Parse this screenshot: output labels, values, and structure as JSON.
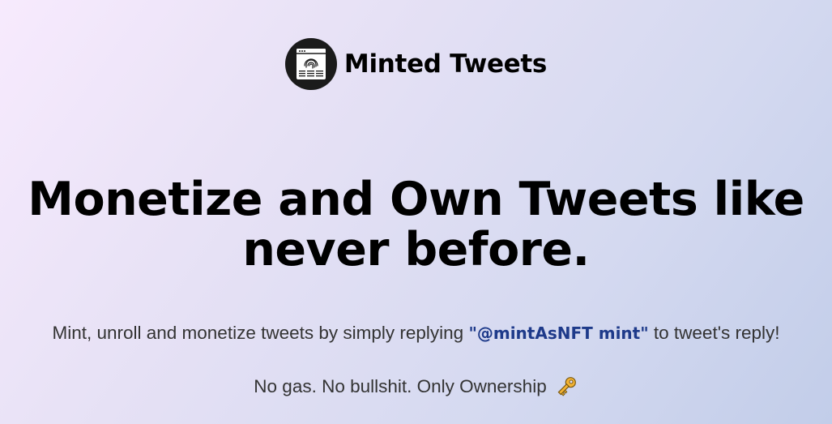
{
  "brand": {
    "name": "Minted Tweets",
    "logo_icon": "fingerprint-browser-icon"
  },
  "hero": {
    "headline_line1": "Monetize and Own Tweets like",
    "headline_line2": "never before.",
    "subtitle_before": "Mint, unroll and monetize tweets by simply replying ",
    "subtitle_handle": "\"@mintAsNFT mint\"",
    "subtitle_after": " to tweet's reply!",
    "tagline": "No gas. No bullshit. Only Ownership",
    "tagline_icon": "key-icon"
  },
  "colors": {
    "handle": "#1e3a8a",
    "text": "#333333",
    "logo_bg": "#1b1b1b",
    "key": "#f2b233"
  }
}
